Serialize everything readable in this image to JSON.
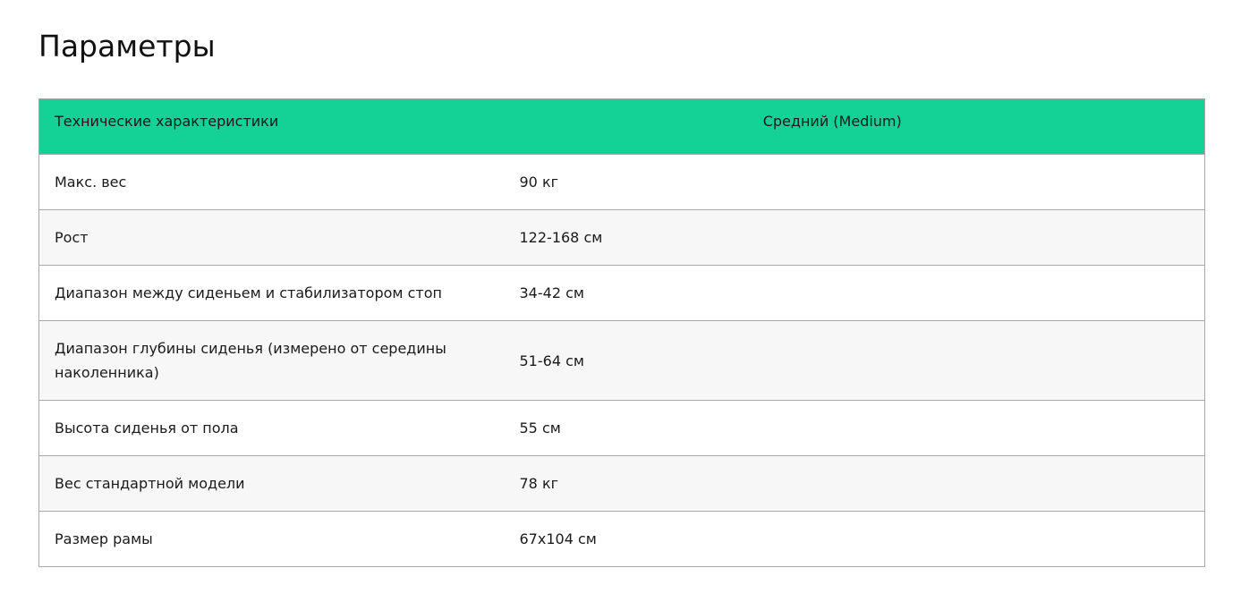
{
  "page": {
    "title": "Параметры"
  },
  "table": {
    "header": {
      "label": "Технические характеристики",
      "value": "Средний (Medium)"
    },
    "rows": [
      {
        "label": "Макс. вес",
        "value": "90 кг"
      },
      {
        "label": "Рост",
        "value": "122-168 см"
      },
      {
        "label": "Диапазон между сиденьем и стабилизатором стоп",
        "value": "34-42 см"
      },
      {
        "label": "Диапазон глубины сиденья (измерено от середины наколенника)",
        "value": "51-64 см"
      },
      {
        "label": "Высота сиденья от пола",
        "value": "55 см"
      },
      {
        "label": "Вес стандартной модели",
        "value": "78 кг"
      },
      {
        "label": "Размер рамы",
        "value": "67х104 см"
      }
    ]
  },
  "colors": {
    "header_background": "#14d196",
    "alternate_row_background": "#f6f7f6",
    "border": "#a8a8a8"
  }
}
